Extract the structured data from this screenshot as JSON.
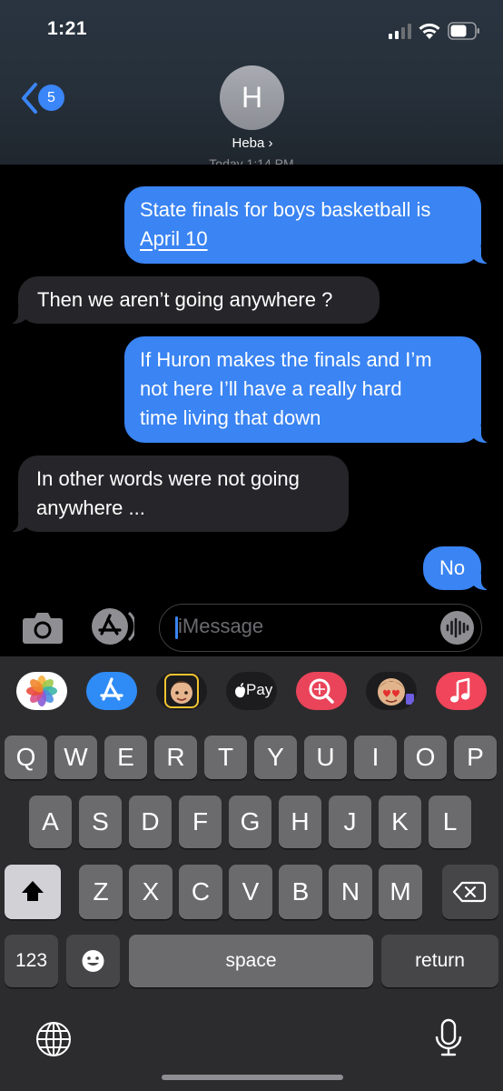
{
  "status_bar": {
    "time": "1:21"
  },
  "header": {
    "back_count": "5",
    "avatar_initial": "H",
    "contact_name": "Heba ›",
    "timestamp": "Today 1:14 PM"
  },
  "messages": [
    {
      "direction": "sent",
      "line1": "State finals for boys basketball is",
      "link": "April 10"
    },
    {
      "direction": "received",
      "text": "Then we aren’t going anywhere ?"
    },
    {
      "direction": "sent",
      "lines": [
        "If Huron makes the finals and I’m",
        "not here I’ll have a really hard",
        "time living that down"
      ]
    },
    {
      "direction": "received",
      "lines": [
        "In other words were not going",
        "anywhere ..."
      ]
    },
    {
      "direction": "sent",
      "text": "No"
    }
  ],
  "input": {
    "placeholder": "iMessage"
  },
  "app_strip": [
    {
      "name": "photos-app-icon"
    },
    {
      "name": "app-store-icon"
    },
    {
      "name": "memoji-stickers-icon"
    },
    {
      "name": "apple-pay-icon",
      "label": "Pay"
    },
    {
      "name": "images-search-icon"
    },
    {
      "name": "animoji-icon"
    },
    {
      "name": "music-icon"
    }
  ],
  "keyboard": {
    "row1": [
      "Q",
      "W",
      "E",
      "R",
      "T",
      "Y",
      "U",
      "I",
      "O",
      "P"
    ],
    "row2": [
      "A",
      "S",
      "D",
      "F",
      "G",
      "H",
      "J",
      "K",
      "L"
    ],
    "row3": [
      "Z",
      "X",
      "C",
      "V",
      "B",
      "N",
      "M"
    ],
    "numbers_label": "123",
    "space_label": "space",
    "return_label": "return"
  },
  "colors": {
    "sent_bubble": "#3a84f3",
    "received_bubble": "#26262a",
    "keyboard_bg": "#2c2c2e"
  }
}
